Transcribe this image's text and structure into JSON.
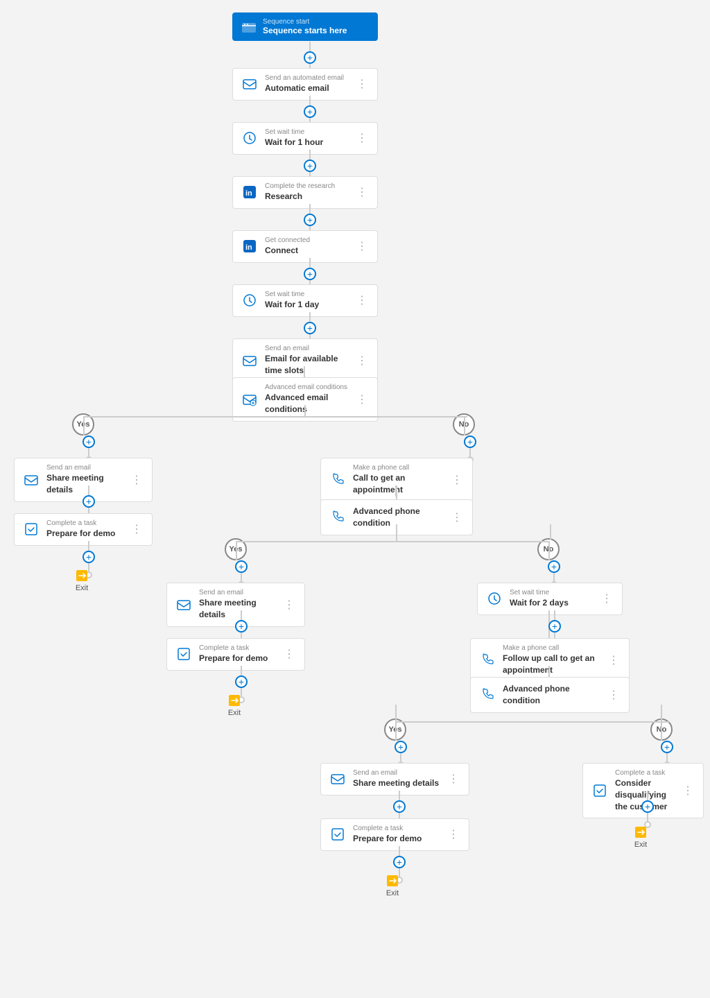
{
  "nodes": {
    "sequence_start": {
      "label": "Sequence start",
      "title": "Sequence starts here"
    },
    "auto_email": {
      "label": "Send an automated email",
      "title": "Automatic email"
    },
    "wait_1hr": {
      "label": "Set wait time",
      "title": "Wait for 1 hour"
    },
    "research": {
      "label": "Complete the research",
      "title": "Research"
    },
    "connect": {
      "label": "Get connected",
      "title": "Connect"
    },
    "wait_1day": {
      "label": "Set wait time",
      "title": "Wait for 1 day"
    },
    "email_timeslots": {
      "label": "Send an email",
      "title": "Email for available time slots"
    },
    "adv_email_cond": {
      "label": "Advanced email conditions",
      "title": "Advanced email conditions"
    },
    "yes_label": "Yes",
    "no_label": "No",
    "left_share_meeting": {
      "label": "Send an email",
      "title": "Share meeting details"
    },
    "left_prepare_demo": {
      "label": "Complete a task",
      "title": "Prepare for demo"
    },
    "right_call_appt": {
      "label": "Make a phone call",
      "title": "Call to get an appointment"
    },
    "adv_phone_cond": {
      "label": "",
      "title": "Advanced phone condition"
    },
    "exit_label": "Exit",
    "l2_yes": "Yes",
    "l2_no": "No",
    "l2_share_meeting": {
      "label": "Send an email",
      "title": "Share meeting details"
    },
    "l2_prepare_demo": {
      "label": "Complete a task",
      "title": "Prepare for demo"
    },
    "l2_wait_2days": {
      "label": "Set wait time",
      "title": "Wait for 2 days"
    },
    "l2_followup_call": {
      "label": "Make a phone call",
      "title": "Follow up call to get an appointment"
    },
    "l2_adv_phone": {
      "label": "",
      "title": "Advanced phone condition"
    },
    "l3_yes": "Yes",
    "l3_no": "No",
    "l3_share_meeting": {
      "label": "Send an email",
      "title": "Share meeting details"
    },
    "l3_prepare_demo": {
      "label": "Complete a task",
      "title": "Prepare for demo"
    },
    "l3_disqualify": {
      "label": "Complete a task",
      "title": "Consider disqualifying the customer"
    }
  },
  "colors": {
    "blue": "#0078d4",
    "connector": "#ccc",
    "card_border": "#ddd",
    "text_dark": "#333",
    "text_light": "#888"
  }
}
